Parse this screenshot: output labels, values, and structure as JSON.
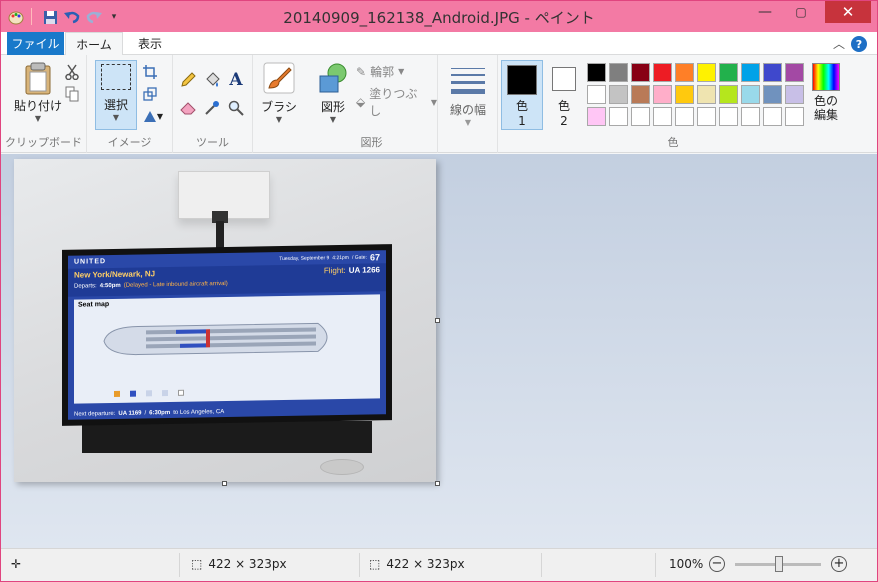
{
  "window": {
    "title": "20140909_162138_Android.JPG - ペイント"
  },
  "tabs": {
    "file": "ファイル",
    "home": "ホーム",
    "view": "表示"
  },
  "clipboard": {
    "paste": "貼り付け",
    "group": "クリップボード"
  },
  "image": {
    "select": "選択",
    "group": "イメージ"
  },
  "tools": {
    "group": "ツール",
    "text_tool": "A"
  },
  "brush": {
    "label": "ブラシ"
  },
  "shapes": {
    "label": "図形",
    "outline": "輪郭",
    "fill": "塗りつぶし",
    "group": "図形"
  },
  "size": {
    "label": "線の幅"
  },
  "colors": {
    "color1_label": "色",
    "color1_num": "1",
    "color2_label": "色",
    "color2_num": "2",
    "edit_label": "色の\n編集",
    "group": "色",
    "color1": "#000000",
    "color2": "#ffffff",
    "palette_row1": [
      "#000000",
      "#7f7f7f",
      "#880015",
      "#ed1c24",
      "#ff7f27",
      "#fff200",
      "#22b14c",
      "#00a2e8",
      "#3f48cc",
      "#a349a4"
    ],
    "palette_row2": [
      "#ffffff",
      "#c3c3c3",
      "#b97a57",
      "#ffaec9",
      "#ffc90e",
      "#efe4b0",
      "#b5e61d",
      "#99d9ea",
      "#7092be",
      "#c8bfe7"
    ],
    "palette_row3": [
      "#ffc6f5",
      "#ffffff",
      "#ffffff",
      "#ffffff",
      "#ffffff",
      "#ffffff",
      "#ffffff",
      "#ffffff",
      "#ffffff",
      "#ffffff"
    ]
  },
  "photo": {
    "airline": "UNITED",
    "date": "Tuesday, September 9",
    "time": "4:21pm",
    "gate_label": "/ Gate:",
    "gate": "67",
    "route": "New York/Newark, NJ",
    "flight_label": "Flight:",
    "flight": "UA 1266",
    "departs_label": "Departs:",
    "departs": "4:50pm",
    "delay": "(Delayed - Late inbound aircraft arrival)",
    "seatmap": "Seat map",
    "next_label": "Next departure:",
    "next": "UA 1169",
    "next_time": "6:30pm",
    "next_dest": "to Los Angeles, CA"
  },
  "status": {
    "selection_size": "422 × 323px",
    "image_size": "422 × 323px",
    "zoom": "100%"
  }
}
